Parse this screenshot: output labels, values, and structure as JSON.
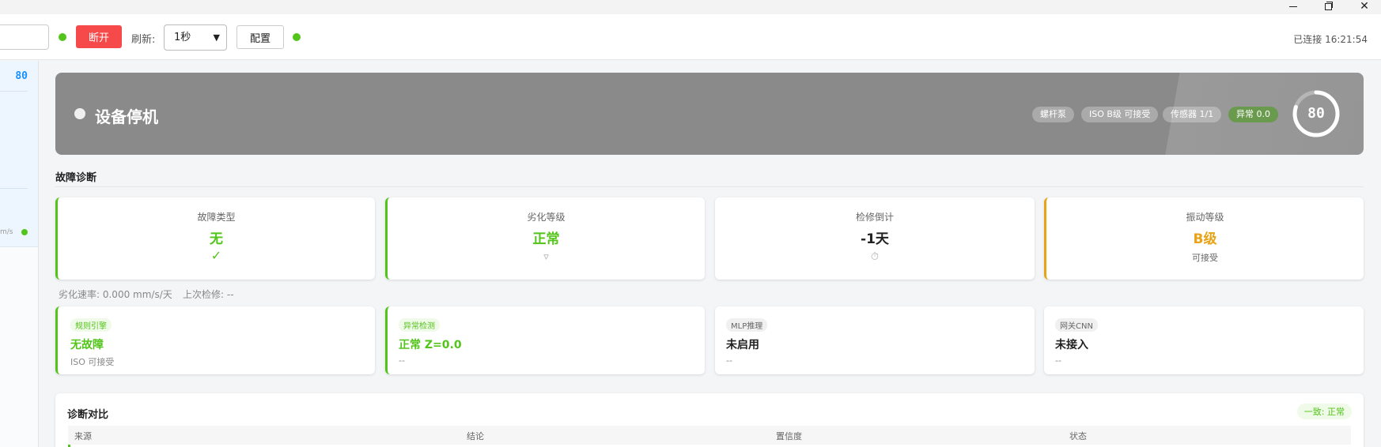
{
  "window": {
    "minimize_glyph": "",
    "maximize_glyph": "",
    "close_glyph": "✕"
  },
  "toolbar": {
    "disconnect_label": "断开",
    "refresh_label": "刷新:",
    "refresh_value": "1秒",
    "config_label": "配置",
    "status": "已连接 16:21:54"
  },
  "sidebar": {
    "value": "80",
    "unit": "m/s"
  },
  "banner": {
    "title": "设备停机",
    "chips": [
      "螺杆泵",
      "ISO B级 可接受",
      "传感器 1/1",
      "异常 0.0"
    ],
    "health_score": "80",
    "health_fraction": 0.8
  },
  "diagnosis": {
    "title": "故障诊断",
    "cards": [
      {
        "label": "故障类型",
        "value": "无",
        "sub": "✓"
      },
      {
        "label": "劣化等级",
        "value": "正常",
        "sub": "▿"
      },
      {
        "label": "检修倒计",
        "value": "-1天",
        "sub": "⏱"
      },
      {
        "label": "振动等级",
        "value": "B级",
        "sub": "可接受"
      }
    ],
    "degradation_rate": "劣化速率: 0.000 mm/s/天",
    "last_maintenance": "上次检修: --"
  },
  "engines": [
    {
      "tag": "规则引擎",
      "value": "无故障",
      "sub": "ISO 可接受"
    },
    {
      "tag": "异常检测",
      "value": "正常 Z=0.0",
      "sub": "--"
    },
    {
      "tag": "MLP推理",
      "value": "未启用",
      "sub": "--"
    },
    {
      "tag": "网关CNN",
      "value": "未接入",
      "sub": "--"
    }
  ],
  "comparison": {
    "title": "诊断对比",
    "badge": "一致: 正常",
    "columns": [
      "来源",
      "结论",
      "置信度",
      "状态"
    ]
  },
  "colors": {
    "accent_green": "#52c41a",
    "accent_orange": "#e8a317",
    "danger": "#f5494a",
    "link_blue": "#1890ff"
  }
}
